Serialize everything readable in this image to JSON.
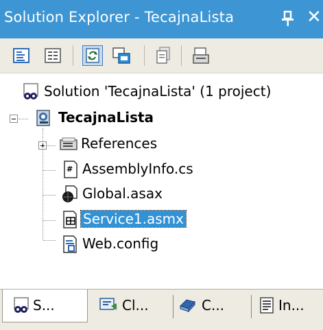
{
  "window": {
    "title": "Solution Explorer - TecajnaLista",
    "close_glyph": "✕"
  },
  "toolbar": {
    "buttons": [
      {
        "name": "properties-icon"
      },
      {
        "name": "show-all-files-icon"
      },
      {
        "name": "refresh-icon"
      },
      {
        "name": "nest-related-files-icon"
      },
      {
        "name": "copy-project-icon"
      },
      {
        "name": "view-designer-icon"
      }
    ]
  },
  "tree": {
    "solution": "Solution 'TecajnaLista' (1 project)",
    "project": "TecajnaLista",
    "items": [
      {
        "label": "References",
        "icon": "references-icon"
      },
      {
        "label": "AssemblyInfo.cs",
        "icon": "cs-file-icon"
      },
      {
        "label": "Global.asax",
        "icon": "asax-file-icon"
      },
      {
        "label": "Service1.asmx",
        "icon": "asmx-file-icon",
        "selected": true
      },
      {
        "label": "Web.config",
        "icon": "config-file-icon"
      }
    ]
  },
  "tabs": [
    {
      "label": "S...",
      "icon": "solution-explorer-icon",
      "active": true
    },
    {
      "label": "Cl...",
      "icon": "class-view-icon"
    },
    {
      "label": "C...",
      "icon": "contents-icon"
    },
    {
      "label": "In...",
      "icon": "index-icon"
    }
  ],
  "colors": {
    "titlebar": "#3d95d3",
    "toolbar": "#eeebe2",
    "selection": "#3292d6"
  }
}
